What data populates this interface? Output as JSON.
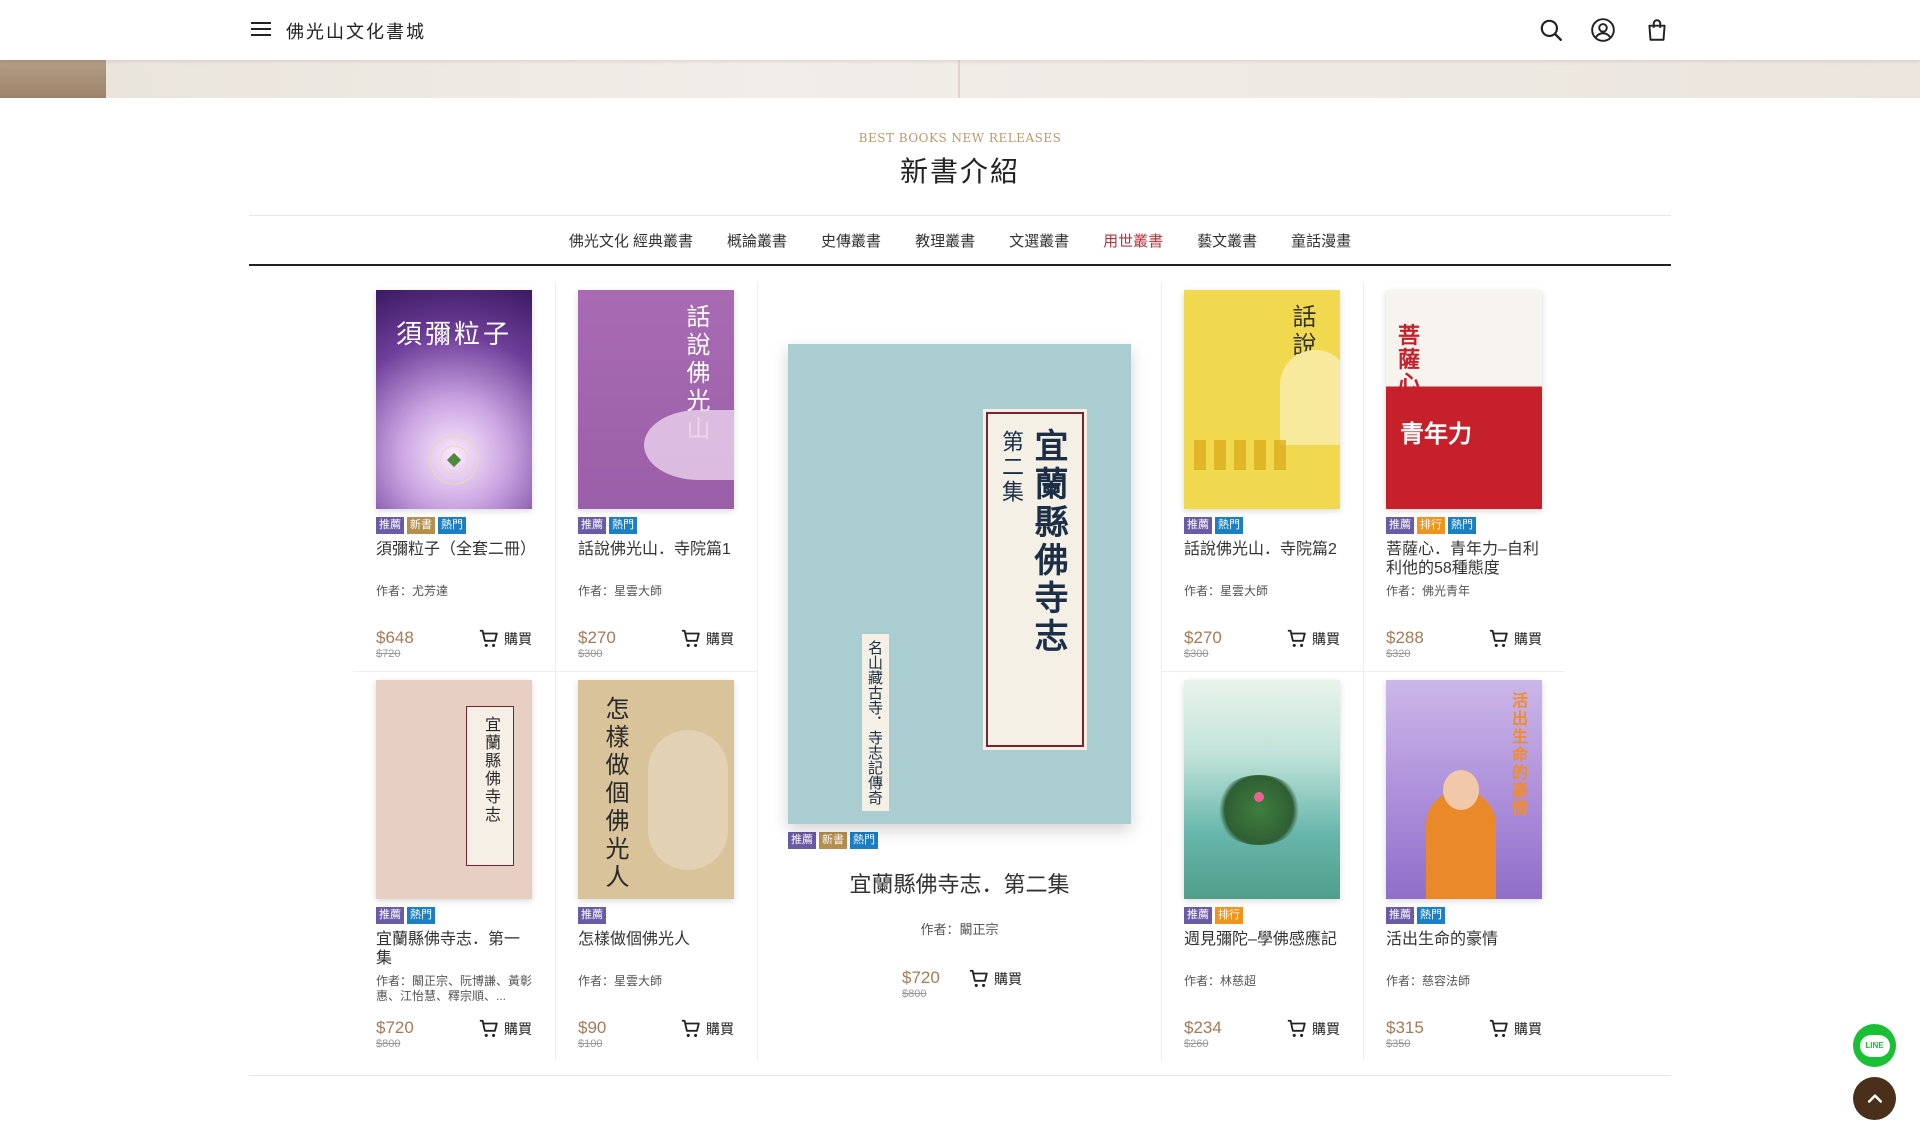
{
  "header": {
    "site_title": "佛光山文化書城"
  },
  "section": {
    "subtitle": "BEST BOOKS NEW RELEASES",
    "title": "新書介紹"
  },
  "tabs": [
    {
      "label": "佛光文化 經典叢書"
    },
    {
      "label": "概論叢書"
    },
    {
      "label": "史傳叢書"
    },
    {
      "label": "教理叢書"
    },
    {
      "label": "文選叢書"
    },
    {
      "label": "用世叢書",
      "active": true
    },
    {
      "label": "藝文叢書"
    },
    {
      "label": "童話漫畫"
    }
  ],
  "buy_label": "購買",
  "badge_labels": {
    "rec": "推薦",
    "new": "新書",
    "hot": "熱門",
    "rank": "排行"
  },
  "books": [
    {
      "title": "須彌粒子（全套二冊）",
      "author": "作者：尤芳達",
      "price": "$648",
      "old_price": "$720",
      "cover_text": "須彌粒子"
    },
    {
      "title": "話說佛光山．寺院篇1",
      "author": "作者：星雲大師",
      "price": "$270",
      "old_price": "$300",
      "cover_text": "話說佛光山"
    },
    {
      "title": "話說佛光山．寺院篇2",
      "author": "作者：星雲大師",
      "price": "$270",
      "old_price": "$300",
      "cover_text": "話說佛光山"
    },
    {
      "title": "菩薩心．青年力–自利利他的58種態度",
      "author": "作者：佛光青年",
      "price": "$288",
      "old_price": "$320",
      "cover_text_1": "菩薩心",
      "cover_text_2": "青年力"
    },
    {
      "title": "宜蘭縣佛寺志．第一集",
      "author": "作者：闞正宗、阮博謙、黃彰惠、江怡慧、釋宗順、...",
      "price": "$720",
      "old_price": "$800",
      "cover_text": "宜蘭縣佛寺志"
    },
    {
      "title": "怎樣做個佛光人",
      "author": "作者：星雲大師",
      "price": "$90",
      "old_price": "$100",
      "cover_text": "怎樣做個佛光人"
    },
    {
      "title": "週見彌陀–學佛感應記",
      "author": "作者：林慈超",
      "price": "$234",
      "old_price": "$260"
    },
    {
      "title": "活出生命的豪情",
      "author": "作者：慈容法師",
      "price": "$315",
      "old_price": "$350",
      "cover_text": "活出生命的豪情"
    }
  ],
  "featured": {
    "title": "宜蘭縣佛寺志．第二集",
    "author": "作者：闞正宗",
    "price": "$720",
    "old_price": "$800",
    "cover_main": "宜蘭縣佛寺志",
    "cover_vol": "第二集",
    "cover_side": "名山藏古寺．寺志記傳奇"
  },
  "colors": {
    "accent_red": "#b5343b",
    "price": "#a37b58",
    "line_green": "#19c033",
    "top_brown": "#4a2f1b"
  },
  "floating": {
    "line_label": "LINE"
  }
}
